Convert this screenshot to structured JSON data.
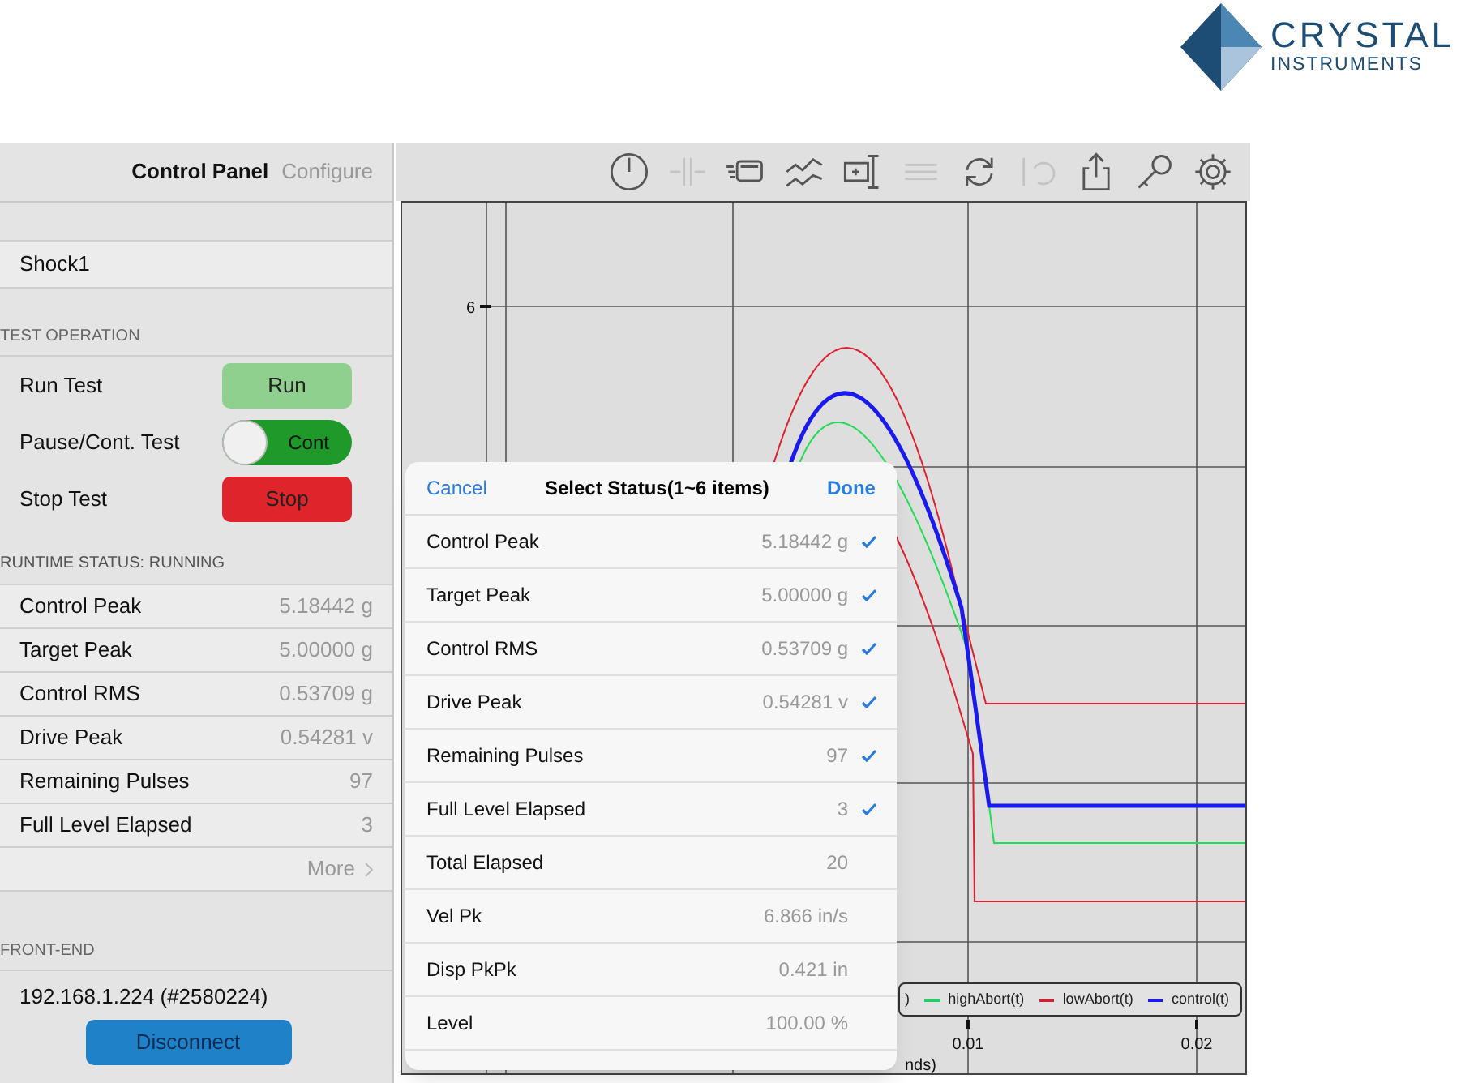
{
  "logo": {
    "line_1": "CRYSTAL",
    "line_2": "INSTRUMENTS"
  },
  "panel_tabs": [
    {
      "label": "Control Panel",
      "selected": true
    },
    {
      "label": "Configure",
      "selected": false
    }
  ],
  "test_name": "Shock1",
  "test_operation": {
    "header": "TEST OPERATION",
    "rows": [
      {
        "kind": "button",
        "label": "Run Test",
        "control": "Run",
        "color": "#8fd08f"
      },
      {
        "kind": "switch",
        "label": "Pause/Cont. Test",
        "control": "Cont",
        "on": true
      },
      {
        "kind": "button",
        "label": "Stop Test",
        "control": "Stop",
        "color": "#e0242c"
      }
    ]
  },
  "runtime_status": {
    "header": "RUNTIME STATUS: RUNNING",
    "rows": [
      {
        "label": "Control Peak",
        "value": "5.18442 g"
      },
      {
        "label": "Target Peak",
        "value": "5.00000 g"
      },
      {
        "label": "Control RMS",
        "value": "0.53709 g"
      },
      {
        "label": "Drive Peak",
        "value": "0.54281 v"
      },
      {
        "label": "Remaining Pulses",
        "value": "97"
      },
      {
        "label": "Full Level Elapsed",
        "value": "3"
      }
    ],
    "more": "More"
  },
  "front_end": {
    "header": "FRONT-END",
    "address": "192.168.1.224 (#2580224)",
    "button": "Disconnect"
  },
  "toolbar": [
    {
      "kind": "clock",
      "disabled": false
    },
    {
      "kind": "cursor",
      "disabled": true
    },
    {
      "kind": "cards",
      "disabled": false
    },
    {
      "kind": "lines",
      "disabled": false
    },
    {
      "kind": "crosshair",
      "disabled": false
    },
    {
      "kind": "bars",
      "disabled": true
    },
    {
      "kind": "refresh",
      "disabled": false
    },
    {
      "kind": "undo",
      "disabled": true
    },
    {
      "kind": "share",
      "disabled": false
    },
    {
      "kind": "key",
      "disabled": false
    },
    {
      "kind": "gear",
      "disabled": false
    }
  ],
  "chart": {
    "y_tick": "6",
    "x_ticks": [
      "0.01",
      "0.02"
    ],
    "x_label_fragment": "nds)",
    "legend": [
      {
        "label": ")"
      },
      {
        "label": "highAbort(t)",
        "color": "#22cc66"
      },
      {
        "label": "lowAbort(t)",
        "color": "#cc2233"
      },
      {
        "label": "control(t)",
        "color": "#1a1aee"
      }
    ]
  },
  "popup": {
    "cancel": "Cancel",
    "title": "Select Status(1~6 items)",
    "done": "Done",
    "items": [
      {
        "label": "Control Peak",
        "value": "5.18442 g",
        "checked": true
      },
      {
        "label": "Target Peak",
        "value": "5.00000 g",
        "checked": true
      },
      {
        "label": "Control RMS",
        "value": "0.53709 g",
        "checked": true
      },
      {
        "label": "Drive Peak",
        "value": "0.54281 v",
        "checked": true
      },
      {
        "label": "Remaining Pulses",
        "value": "97",
        "checked": true
      },
      {
        "label": "Full Level Elapsed",
        "value": "3",
        "checked": true
      },
      {
        "label": "Total Elapsed",
        "value": "20",
        "checked": false
      },
      {
        "label": "Vel Pk",
        "value": "6.866 in/s",
        "checked": false
      },
      {
        "label": "Disp PkPk",
        "value": "0.421 in",
        "checked": false
      },
      {
        "label": "Level",
        "value": "100.00 %",
        "checked": false
      }
    ]
  }
}
